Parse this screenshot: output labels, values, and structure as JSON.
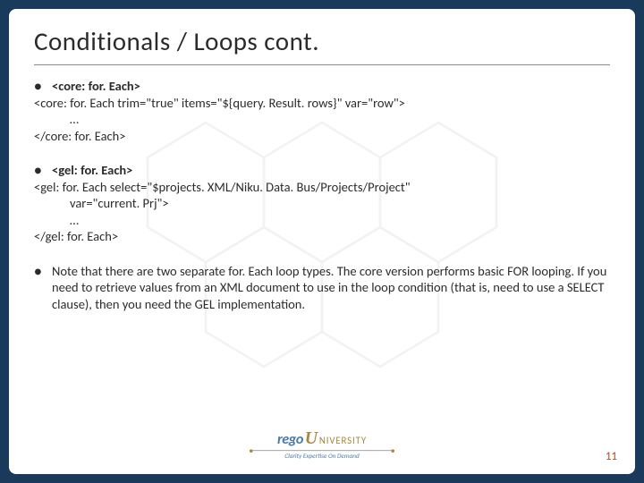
{
  "title": "Conditionals / Loops cont.",
  "section1": {
    "heading": "<core: for. Each>",
    "open": "<core: for. Each trim=\"true\" items=\"${query. Result. rows}\" var=\"row\">",
    "body": "…",
    "close": "</core: for. Each>"
  },
  "section2": {
    "heading": "<gel: for. Each>",
    "open": "<gel: for. Each select=\"$projects. XML/Niku. Data. Bus/Projects/Project\"",
    "open2": "var=\"current. Prj\">",
    "body": "…",
    "close": "</gel: for. Each>"
  },
  "section3": {
    "note": "Note that there are two separate for. Each loop types. The core version performs basic FOR looping. If you need to retrieve values from an XML document to use in the loop condition (that is, need to use a SELECT clause), then you need the GEL implementation."
  },
  "logo": {
    "brand": "rego",
    "u": "U",
    "suffix": "NIVERSITY",
    "tagline": "Clarity Expertise On Demand"
  },
  "page_number": "11"
}
